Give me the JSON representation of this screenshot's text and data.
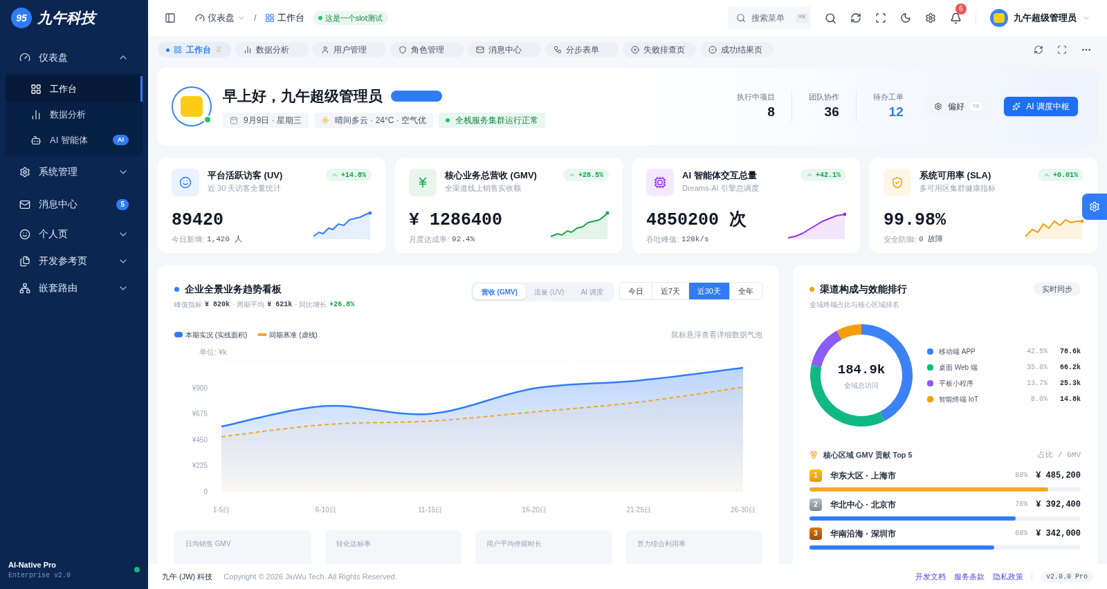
{
  "sidebar": {
    "logo_mark": "95",
    "brand": "九午科技",
    "menu": [
      {
        "kind": "group",
        "label": "仪表盘",
        "expanded": true,
        "children": [
          {
            "label": "工作台",
            "selected": true
          },
          {
            "label": "数据分析",
            "selected": false
          },
          {
            "label": "AI 智能体",
            "selected": false,
            "badge": "AI"
          }
        ]
      },
      {
        "kind": "group",
        "label": "系统管理",
        "expanded": false
      },
      {
        "kind": "link",
        "label": "消息中心",
        "badge": "5"
      },
      {
        "kind": "group",
        "label": "个人页",
        "expanded": false
      },
      {
        "kind": "group",
        "label": "开发参考页",
        "expanded": false
      },
      {
        "kind": "group",
        "label": "嵌套路由",
        "expanded": false
      }
    ],
    "product": "AI-Native Pro",
    "edition": "Enterprise v2.0",
    "online": true
  },
  "header": {
    "breadcrumb": [
      {
        "label": "仪表盘",
        "dropdown": true
      },
      {
        "label": "工作台",
        "dropdown": false
      }
    ],
    "separator": "/",
    "slot_tag": "这是一个slot测试",
    "search": {
      "placeholder": "搜索菜单",
      "shortcut": "⌘K"
    },
    "notifications": "6",
    "user": "九午超级管理员"
  },
  "tabs": [
    {
      "label": "工作台",
      "selected": true,
      "pinned": true
    },
    {
      "label": "数据分析",
      "selected": false,
      "pinned": false
    },
    {
      "label": "用户管理",
      "selected": false,
      "pinned": false
    },
    {
      "label": "角色管理",
      "selected": false,
      "pinned": false
    },
    {
      "label": "消息中心",
      "selected": false,
      "pinned": false
    },
    {
      "label": "分步表单",
      "selected": false,
      "pinned": false
    },
    {
      "label": "失败排查页",
      "selected": false,
      "pinned": false
    },
    {
      "label": "成功结果页",
      "selected": false,
      "pinned": false
    }
  ],
  "welcome": {
    "greeting": "早上好，九午超级管理员",
    "online": true,
    "chips": [
      {
        "kind": "date",
        "text": "9月9日 · 星期三"
      },
      {
        "kind": "weather",
        "text": "晴间多云 · 24°C · 空气优"
      },
      {
        "kind": "status",
        "text": "全栈服务集群运行正常"
      }
    ],
    "stats": [
      {
        "label": "执行中项目",
        "value": "8",
        "highlight": false
      },
      {
        "label": "团队协作",
        "value": "36",
        "highlight": false
      },
      {
        "label": "待办工单",
        "value": "12",
        "highlight": true
      }
    ],
    "preference": {
      "label": "偏好",
      "shortcut": "⌥S"
    },
    "primary_button": "AI 调度中枢"
  },
  "kpis": [
    {
      "color": "#2f7cf6",
      "title": "平台活跃访客 (UV)",
      "subtitle": "近 30 天访客全量统计",
      "trend": "+14.8%",
      "value": "89420",
      "footer_label": "今日新增:",
      "footer_value": "1,420 人"
    },
    {
      "color": "#16a34a",
      "title": "核心业务总营收 (GMV)",
      "subtitle": "全渠道线上销售实收额",
      "trend": "+28.5%",
      "value": "¥ 1286400",
      "footer_label": "月度达成率:",
      "footer_value": "92.4%"
    },
    {
      "color": "#9333ea",
      "title": "AI 智能体交互总量",
      "subtitle": "Dreams-AI 引擎总调度",
      "trend": "+42.1%",
      "value": "4850200 次",
      "footer_label": "吞吐峰值:",
      "footer_value": "128k/s"
    },
    {
      "color": "#f59e0b",
      "title": "系统可用率 (SLA)",
      "subtitle": "多可用区集群健康指标",
      "trend": "+0.01%",
      "value": "99.98%",
      "footer_label": "安全防御:",
      "footer_value": "0 故障"
    }
  ],
  "trend": {
    "title": "企业全景业务趋势看板",
    "metrics": [
      {
        "label": "峰值指标",
        "value": "¥ 820k",
        "positive": false
      },
      {
        "label": "· 周期平均",
        "value": "¥ 621k",
        "positive": false
      },
      {
        "label": "· 同比增长",
        "value": "+26.8%",
        "positive": true
      }
    ],
    "views": [
      {
        "label": "营收 (GMV)",
        "selected": true
      },
      {
        "label": "流量 (UV)",
        "selected": false
      },
      {
        "label": "AI 调度",
        "selected": false
      }
    ],
    "ranges": [
      {
        "label": "今日",
        "selected": false
      },
      {
        "label": "近7天",
        "selected": false
      },
      {
        "label": "近30天",
        "selected": true
      },
      {
        "label": "全年",
        "selected": false
      }
    ],
    "hint": "鼠标悬浮查看详细数据气泡",
    "chart_data": {
      "type": "area",
      "ylabel": "单位: ¥k",
      "grid": true,
      "legend": "top",
      "categories": [
        "1-5日",
        "6-10日",
        "11-15日",
        "16-20日",
        "21-25日",
        "26-30日"
      ],
      "series": [
        {
          "name": "本期实况 (实线面积)",
          "color": "#2f7cf6",
          "values": [
            563,
            740,
            672,
            893,
            961,
            1071
          ]
        },
        {
          "name": "同期基准 (虚线)",
          "color": "#f5a623",
          "values": [
            474,
            580,
            610,
            689,
            774,
            903
          ]
        }
      ],
      "ylim": [
        0,
        1125
      ],
      "yticks": [
        {
          "value": 0,
          "label": "0"
        },
        {
          "value": 225,
          "label": "¥225"
        },
        {
          "value": 450,
          "label": "¥450"
        },
        {
          "value": 675,
          "label": "¥675"
        },
        {
          "value": 900,
          "label": "¥900"
        }
      ]
    },
    "summary": [
      "日均销售 GMV",
      "转化达标率",
      "用户平均停留时长",
      "算力综合利用率"
    ]
  },
  "channels": {
    "title": "渠道构成与效能排行",
    "subtitle": "全域终端占比与核心区域排名",
    "tag": "实时同步",
    "total": "184.9k",
    "total_label": "全域总访问",
    "legend_rows": [
      {
        "share": "42.5%",
        "amount": "78.6k",
        "color": "#3b82f6"
      },
      {
        "share": "35.8%",
        "amount": "66.2k",
        "color": "#10b981"
      },
      {
        "share": "13.7%",
        "amount": "25.3k",
        "color": "#8b5cf6"
      },
      {
        "share": "8.0%",
        "amount": "14.8k",
        "color": "#f59e0b"
      }
    ],
    "chart_data": {
      "type": "donut",
      "legend": "right",
      "categories": [
        "移动端 APP",
        "桌面 Web 端",
        "平板小程序",
        "智能终端 IoT"
      ],
      "values": [
        42.5,
        35.8,
        13.7,
        8.0
      ]
    },
    "ranking_title": "核心区域 GMV 贡献 Top 5",
    "ranking_header": "占比 / GMV",
    "ranking": [
      {
        "rank": "1",
        "name": "华东大区 · 上海市",
        "share": "88%",
        "value": "¥ 485,200",
        "level": 0.88,
        "color": "#f5a623"
      },
      {
        "rank": "2",
        "name": "华北中心 · 北京市",
        "share": "76%",
        "value": "¥ 392,400",
        "level": 0.76,
        "color": "#2f7cf6"
      },
      {
        "rank": "3",
        "name": "华南沿海 · 深圳市",
        "share": "68%",
        "value": "¥ 342,000",
        "level": 0.68,
        "color": "#2f7cf6"
      }
    ]
  },
  "footer": {
    "brand": "九午 (JW) 科技",
    "copyright": "Copyright © 2026 JiuWu Tech. All Rights Reserved.",
    "links": [
      "开发文档",
      "服务条款",
      "隐私政策"
    ],
    "version": "v2.0.0 Pro"
  }
}
